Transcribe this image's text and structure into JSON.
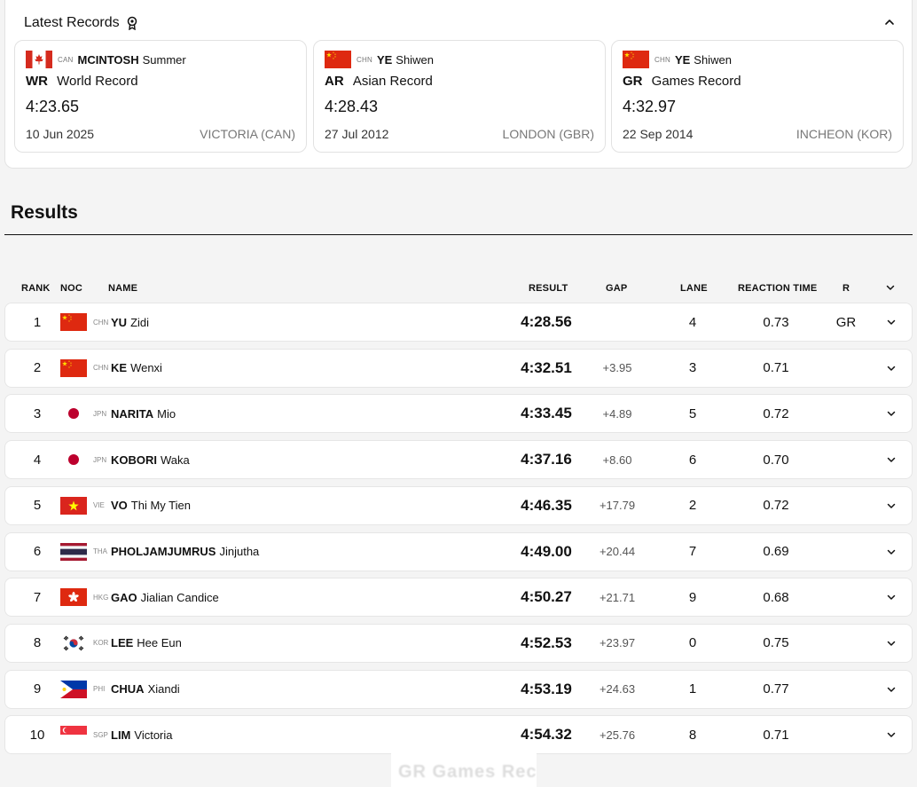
{
  "records": {
    "title": "Latest Records",
    "items": [
      {
        "flag": "CAN",
        "noc": "CAN",
        "surname": "MCINTOSH",
        "given": "Summer",
        "abbr": "WR",
        "type": "World Record",
        "time": "4:23.65",
        "date": "10 Jun 2025",
        "place": "VICTORIA (CAN)"
      },
      {
        "flag": "CHN",
        "noc": "CHN",
        "surname": "YE",
        "given": "Shiwen",
        "abbr": "AR",
        "type": "Asian Record",
        "time": "4:28.43",
        "date": "27 Jul 2012",
        "place": "LONDON (GBR)"
      },
      {
        "flag": "CHN",
        "noc": "CHN",
        "surname": "YE",
        "given": "Shiwen",
        "abbr": "GR",
        "type": "Games Record",
        "time": "4:32.97",
        "date": "22 Sep 2014",
        "place": "INCHEON (KOR)"
      }
    ]
  },
  "results": {
    "title": "Results",
    "columns": {
      "rank": "RANK",
      "noc": "NOC",
      "name": "NAME",
      "result": "RESULT",
      "gap": "GAP",
      "lane": "LANE",
      "reaction": "REACTION TIME",
      "record": "R"
    },
    "rows": [
      {
        "rank": "1",
        "flag": "CHN",
        "noc": "CHN",
        "surname": "YU",
        "given": "Zidi",
        "result": "4:28.56",
        "gap": "",
        "lane": "4",
        "reaction": "0.73",
        "record": "GR"
      },
      {
        "rank": "2",
        "flag": "CHN",
        "noc": "CHN",
        "surname": "KE",
        "given": "Wenxi",
        "result": "4:32.51",
        "gap": "+3.95",
        "lane": "3",
        "reaction": "0.71",
        "record": ""
      },
      {
        "rank": "3",
        "flag": "JPN",
        "noc": "JPN",
        "surname": "NARITA",
        "given": "Mio",
        "result": "4:33.45",
        "gap": "+4.89",
        "lane": "5",
        "reaction": "0.72",
        "record": ""
      },
      {
        "rank": "4",
        "flag": "JPN",
        "noc": "JPN",
        "surname": "KOBORI",
        "given": "Waka",
        "result": "4:37.16",
        "gap": "+8.60",
        "lane": "6",
        "reaction": "0.70",
        "record": ""
      },
      {
        "rank": "5",
        "flag": "VIE",
        "noc": "VIE",
        "surname": "VO",
        "given": "Thi My Tien",
        "result": "4:46.35",
        "gap": "+17.79",
        "lane": "2",
        "reaction": "0.72",
        "record": ""
      },
      {
        "rank": "6",
        "flag": "THA",
        "noc": "THA",
        "surname": "PHOLJAMJUMRUS",
        "given": "Jinjutha",
        "result": "4:49.00",
        "gap": "+20.44",
        "lane": "7",
        "reaction": "0.69",
        "record": ""
      },
      {
        "rank": "7",
        "flag": "HKG",
        "noc": "HKG",
        "surname": "GAO",
        "given": "Jialian Candice",
        "result": "4:50.27",
        "gap": "+21.71",
        "lane": "9",
        "reaction": "0.68",
        "record": ""
      },
      {
        "rank": "8",
        "flag": "KOR",
        "noc": "KOR",
        "surname": "LEE",
        "given": "Hee Eun",
        "result": "4:52.53",
        "gap": "+23.97",
        "lane": "0",
        "reaction": "0.75",
        "record": ""
      },
      {
        "rank": "9",
        "flag": "PHI",
        "noc": "PHI",
        "surname": "CHUA",
        "given": "Xiandi",
        "result": "4:53.19",
        "gap": "+24.63",
        "lane": "1",
        "reaction": "0.77",
        "record": ""
      },
      {
        "rank": "10",
        "flag": "SGP",
        "noc": "SGP",
        "surname": "LIM",
        "given": "Victoria",
        "result": "4:54.32",
        "gap": "+25.76",
        "lane": "8",
        "reaction": "0.71",
        "record": ""
      }
    ]
  },
  "overlay_text": "GR Games Record",
  "icons": {
    "records": "medal-icon",
    "collapse": "chevron-up-icon",
    "expand": "chevron-down-icon"
  }
}
